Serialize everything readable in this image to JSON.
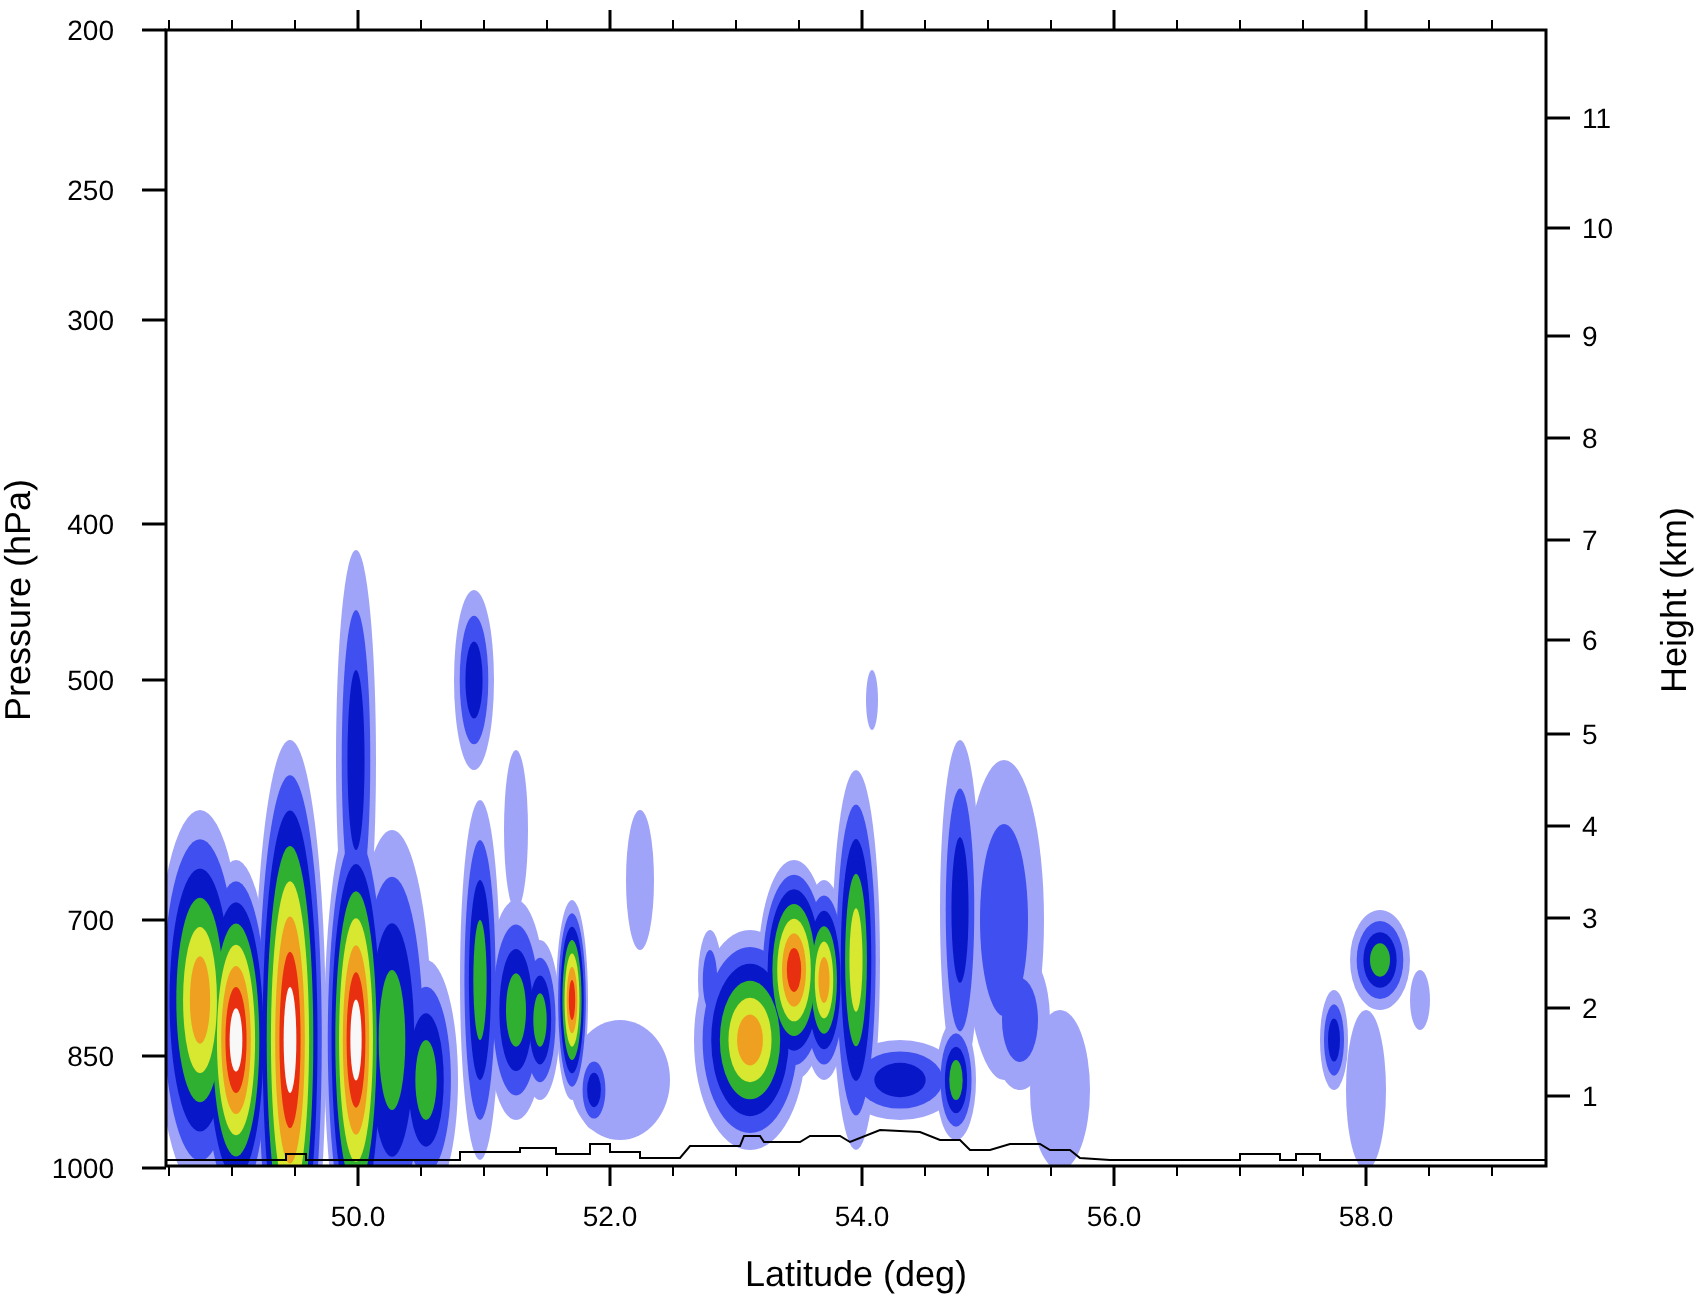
{
  "plot": {
    "left_axis": {
      "title": "Pressure (hPa)",
      "ticks": [
        "200",
        "250",
        "300",
        "400",
        "500",
        "700",
        "850",
        "1000"
      ]
    },
    "right_axis": {
      "title": "Height (km)",
      "ticks": [
        "11",
        "10",
        "9",
        "8",
        "7",
        "6",
        "5",
        "4",
        "3",
        "2",
        "1"
      ]
    },
    "bottom_axis": {
      "title": "Latitude (deg)",
      "ticks": [
        "50.0",
        "52.0",
        "54.0",
        "56.0",
        "58.0"
      ]
    }
  }
}
